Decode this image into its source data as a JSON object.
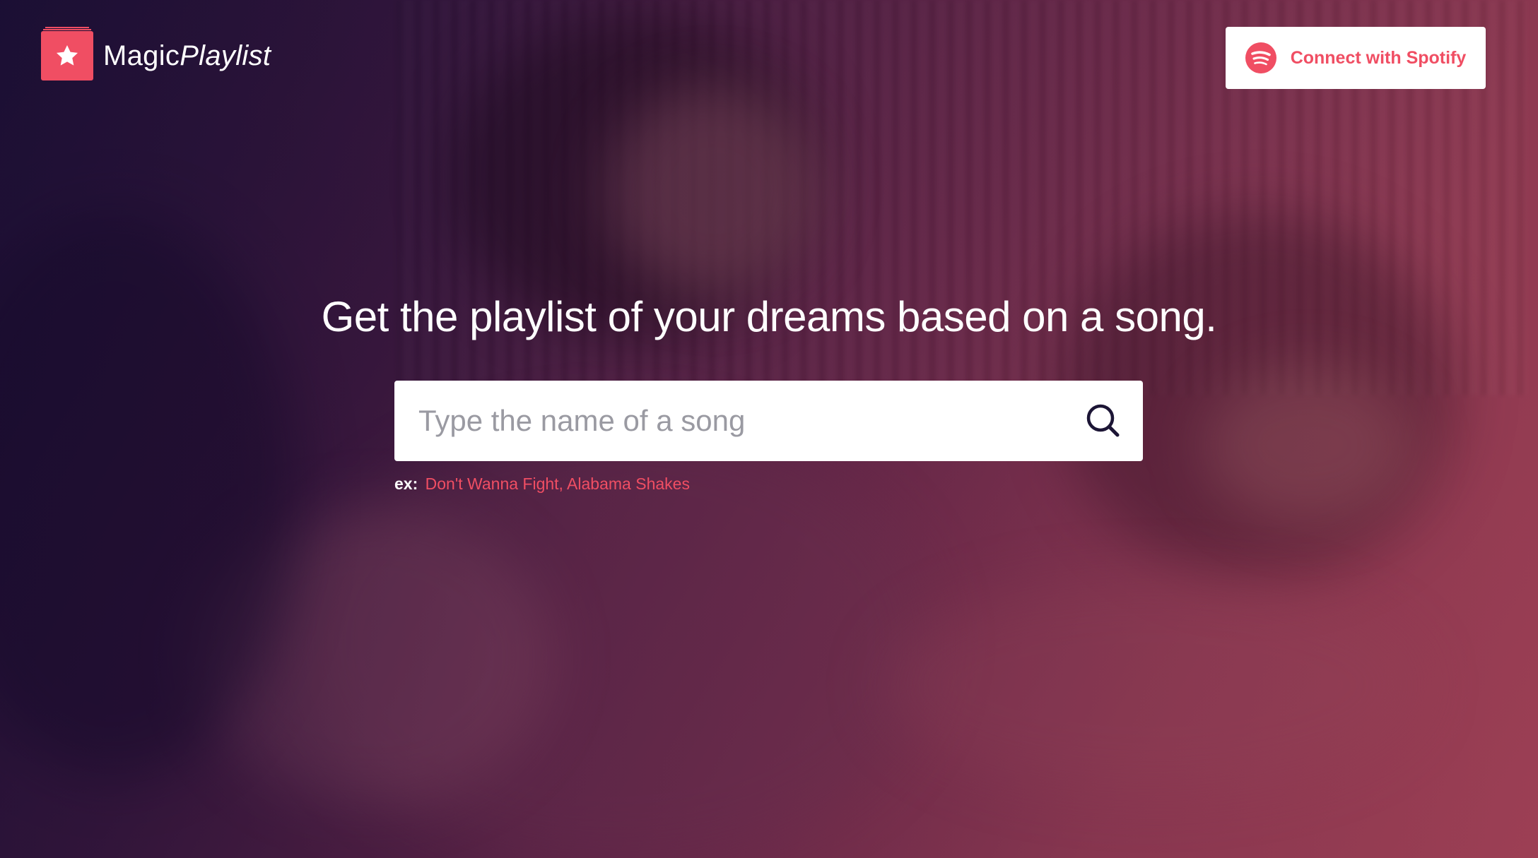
{
  "brand": {
    "name_part1": "Magic",
    "name_part2": "Playlist",
    "logo_icon": "star-icon",
    "accent_color": "#f04e63"
  },
  "header": {
    "connect_button_label": "Connect with Spotify",
    "connect_button_icon": "spotify-icon"
  },
  "hero": {
    "headline": "Get the playlist of your dreams based on a song.",
    "search": {
      "placeholder": "Type the name of a song",
      "value": "",
      "icon": "search-icon"
    },
    "example": {
      "prefix": "ex:",
      "link_text": "Don't Wanna Fight, Alabama Shakes"
    },
    "background": "blurred photo of a singer with guitar and microphone under a purple-red overlay"
  }
}
